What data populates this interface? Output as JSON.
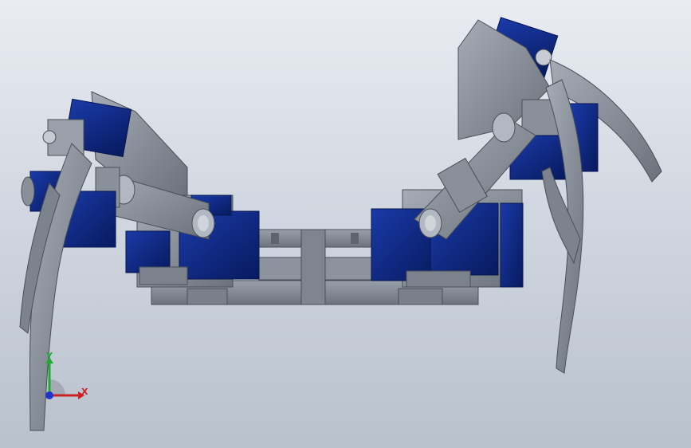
{
  "viewport": {
    "background_top": "#e9ecf2",
    "background_bottom": "#b9c1cd"
  },
  "model": {
    "part_color_gray": "#8b919c",
    "part_color_gray_dark": "#5d626b",
    "servo_color_blue": "#0d2a8a",
    "servo_color_blue_dark": "#061650"
  },
  "triad": {
    "x_label": "X",
    "y_label": "Y",
    "x_color": "#cc2222",
    "y_color": "#22aa33",
    "z_color": "#2233cc"
  }
}
